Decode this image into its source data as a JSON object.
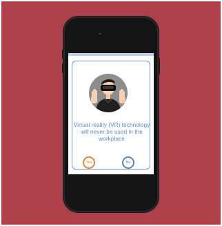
{
  "question": {
    "text": "Virtual reality (VR) technology will never be used in the workplace"
  },
  "answers": {
    "yes_label": "Yes",
    "no_label": "No"
  },
  "colors": {
    "background": "#ad4049",
    "accent_blue": "#6f95c8",
    "yes_orange": "#e48736",
    "no_blue": "#5b83b8"
  },
  "icons": {
    "avatar": "vr-headset-person-icon"
  }
}
